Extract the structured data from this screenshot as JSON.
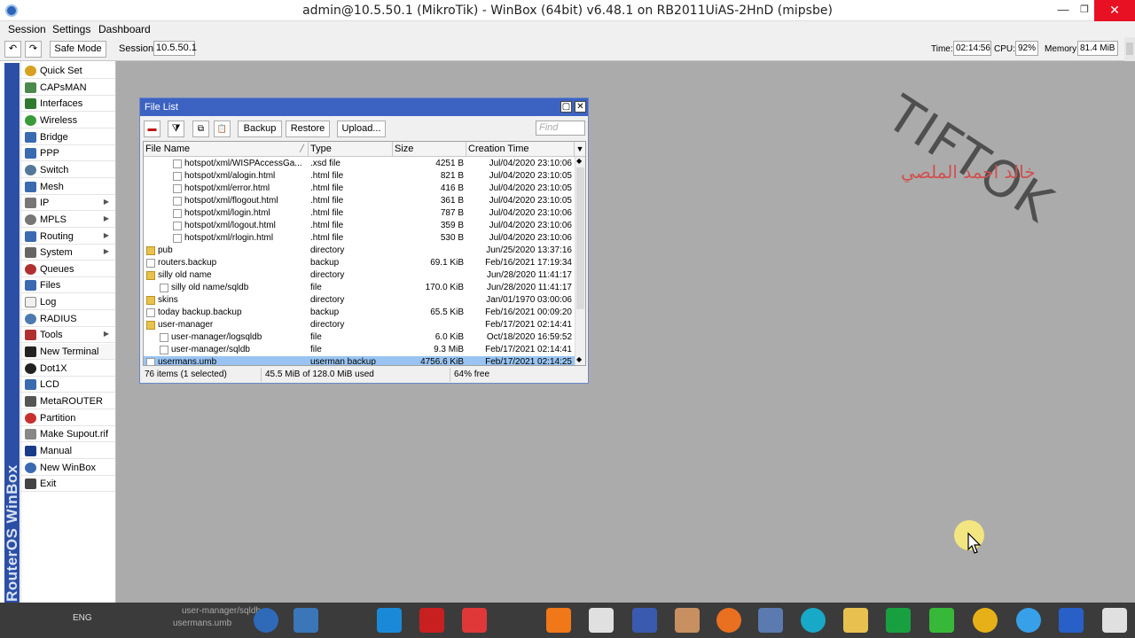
{
  "window": {
    "title": "admin@10.5.50.1 (MikroTik) - WinBox (64bit) v6.48.1 on RB2011UiAS-2HnD (mipsbe)",
    "min": "—",
    "max": "❐",
    "close": "✕"
  },
  "menubar": [
    "Session",
    "Settings",
    "Dashboard"
  ],
  "toolbar": {
    "undo": "↶",
    "redo": "↷",
    "safe_mode": "Safe Mode",
    "session_label": "Session:",
    "session_value": "10.5.50.1"
  },
  "status": {
    "time_label": "Time:",
    "time_value": "02:14:56",
    "cpu_label": "CPU:",
    "cpu_value": "92%",
    "memory_label": "Memory:",
    "memory_value": "81.4 MiB"
  },
  "sidebar_brand": "RouterOS WinBox",
  "menu": [
    {
      "label": "Quick Set",
      "icon": "quickset-icon",
      "color": "#d8a020",
      "arrow": false
    },
    {
      "label": "CAPsMAN",
      "icon": "capsman-icon",
      "color": "#4a8a4a",
      "arrow": false
    },
    {
      "label": "Interfaces",
      "icon": "interfaces-icon",
      "color": "#2f7a2f",
      "arrow": false
    },
    {
      "label": "Wireless",
      "icon": "wireless-icon",
      "color": "#3a9a3a",
      "arrow": false
    },
    {
      "label": "Bridge",
      "icon": "bridge-icon",
      "color": "#3a6ab0",
      "arrow": false
    },
    {
      "label": "PPP",
      "icon": "ppp-icon",
      "color": "#3a6ab0",
      "arrow": false
    },
    {
      "label": "Switch",
      "icon": "switch-icon",
      "color": "#557799",
      "arrow": false
    },
    {
      "label": "Mesh",
      "icon": "mesh-icon",
      "color": "#3a6ab0",
      "arrow": false
    },
    {
      "label": "IP",
      "icon": "ip-icon",
      "color": "#777777",
      "arrow": true
    },
    {
      "label": "MPLS",
      "icon": "mpls-icon",
      "color": "#777777",
      "arrow": true
    },
    {
      "label": "Routing",
      "icon": "routing-icon",
      "color": "#3a6ab0",
      "arrow": true
    },
    {
      "label": "System",
      "icon": "system-icon",
      "color": "#666666",
      "arrow": true
    },
    {
      "label": "Queues",
      "icon": "queues-icon",
      "color": "#b03030",
      "arrow": false
    },
    {
      "label": "Files",
      "icon": "files-icon",
      "color": "#3a6ab0",
      "arrow": false
    },
    {
      "label": "Log",
      "icon": "log-icon",
      "color": "#f0f0f0",
      "arrow": false
    },
    {
      "label": "RADIUS",
      "icon": "radius-icon",
      "color": "#4a7ab0",
      "arrow": false
    },
    {
      "label": "Tools",
      "icon": "tools-icon",
      "color": "#b03030",
      "arrow": true
    },
    {
      "label": "New Terminal",
      "icon": "terminal-icon",
      "color": "#222222",
      "arrow": false
    },
    {
      "label": "Dot1X",
      "icon": "dot1x-icon",
      "color": "#222222",
      "arrow": false
    },
    {
      "label": "LCD",
      "icon": "lcd-icon",
      "color": "#3a6ab0",
      "arrow": false
    },
    {
      "label": "MetaROUTER",
      "icon": "metarouter-icon",
      "color": "#555555",
      "arrow": false
    },
    {
      "label": "Partition",
      "icon": "partition-icon",
      "color": "#c83030",
      "arrow": false
    },
    {
      "label": "Make Supout.rif",
      "icon": "supout-icon",
      "color": "#888888",
      "arrow": false
    },
    {
      "label": "Manual",
      "icon": "manual-icon",
      "color": "#1a3a8a",
      "arrow": false
    },
    {
      "label": "New WinBox",
      "icon": "winbox-icon",
      "color": "#3a6ab0",
      "arrow": false
    },
    {
      "label": "Exit",
      "icon": "exit-icon",
      "color": "#444444",
      "arrow": false
    }
  ],
  "watermark": {
    "text": "TIFTOK",
    "arabic": "خالد احمد الملصي"
  },
  "filelist": {
    "title": "File List",
    "buttons": {
      "remove": "▬",
      "filter": "⧩",
      "copy": "⧉",
      "paste": "📋",
      "backup": "Backup",
      "restore": "Restore",
      "upload": "Upload..."
    },
    "find_placeholder": "Find",
    "columns": [
      "File Name",
      "Type",
      "Size",
      "Creation Time"
    ],
    "rows": [
      {
        "name": "hotspot/xml/WISPAccessGa...",
        "type": ".xsd file",
        "size": "4251 B",
        "time": "Jul/04/2020 23:10:06",
        "kind": "file",
        "indent": 2
      },
      {
        "name": "hotspot/xml/alogin.html",
        "type": ".html file",
        "size": "821 B",
        "time": "Jul/04/2020 23:10:05",
        "kind": "file",
        "indent": 2
      },
      {
        "name": "hotspot/xml/error.html",
        "type": ".html file",
        "size": "416 B",
        "time": "Jul/04/2020 23:10:05",
        "kind": "file",
        "indent": 2
      },
      {
        "name": "hotspot/xml/flogout.html",
        "type": ".html file",
        "size": "361 B",
        "time": "Jul/04/2020 23:10:05",
        "kind": "file",
        "indent": 2
      },
      {
        "name": "hotspot/xml/login.html",
        "type": ".html file",
        "size": "787 B",
        "time": "Jul/04/2020 23:10:06",
        "kind": "file",
        "indent": 2
      },
      {
        "name": "hotspot/xml/logout.html",
        "type": ".html file",
        "size": "359 B",
        "time": "Jul/04/2020 23:10:06",
        "kind": "file",
        "indent": 2
      },
      {
        "name": "hotspot/xml/rlogin.html",
        "type": ".html file",
        "size": "530 B",
        "time": "Jul/04/2020 23:10:06",
        "kind": "file",
        "indent": 2
      },
      {
        "name": "pub",
        "type": "directory",
        "size": "",
        "time": "Jun/25/2020 13:37:16",
        "kind": "dir",
        "indent": 0
      },
      {
        "name": "routers.backup",
        "type": "backup",
        "size": "69.1 KiB",
        "time": "Feb/16/2021 17:19:34",
        "kind": "file",
        "indent": 0
      },
      {
        "name": "silly old name",
        "type": "directory",
        "size": "",
        "time": "Jun/28/2020 11:41:17",
        "kind": "dir",
        "indent": 0
      },
      {
        "name": "silly old name/sqldb",
        "type": "file",
        "size": "170.0 KiB",
        "time": "Jun/28/2020 11:41:17",
        "kind": "file",
        "indent": 1
      },
      {
        "name": "skins",
        "type": "directory",
        "size": "",
        "time": "Jan/01/1970 03:00:06",
        "kind": "dir",
        "indent": 0
      },
      {
        "name": "today backup.backup",
        "type": "backup",
        "size": "65.5 KiB",
        "time": "Feb/16/2021 00:09:20",
        "kind": "file",
        "indent": 0
      },
      {
        "name": "user-manager",
        "type": "directory",
        "size": "",
        "time": "Feb/17/2021 02:14:41",
        "kind": "dir",
        "indent": 0
      },
      {
        "name": "user-manager/logsqldb",
        "type": "file",
        "size": "6.0 KiB",
        "time": "Oct/18/2020 16:59:52",
        "kind": "file",
        "indent": 1
      },
      {
        "name": "user-manager/sqldb",
        "type": "file",
        "size": "9.3 MiB",
        "time": "Feb/17/2021 02:14:41",
        "kind": "file",
        "indent": 1
      },
      {
        "name": "usermans.umb",
        "type": "userman backup",
        "size": "4756.6 KiB",
        "time": "Feb/17/2021 02:14:25",
        "kind": "file",
        "indent": 0,
        "selected": true
      }
    ],
    "status": {
      "items": "76 items (1 selected)",
      "usage": "45.5 MiB of 128.0 MiB used",
      "free": "64% free"
    }
  },
  "taskbar": {
    "lang": "ENG",
    "pinned": [
      "user-manager/sqldb",
      "usermans.umb"
    ],
    "icons": [
      "winbox-icon",
      "network-icon",
      "teamviewer-icon",
      "cf-icon",
      "anydesk-icon",
      "xampp-icon",
      "window-icon",
      "computer-icon",
      "photo-icon",
      "firefox-icon",
      "network-tool-icon",
      "globe-icon",
      "folder-icon",
      "excel-icon",
      "wifi-icon",
      "chrome-icon",
      "chat-icon",
      "shield-icon",
      "windows-icon"
    ]
  }
}
